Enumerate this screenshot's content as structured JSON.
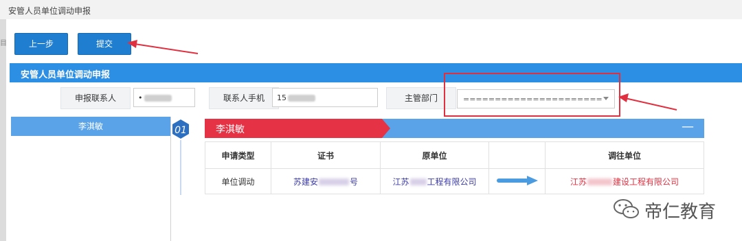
{
  "window": {
    "title": "安管人员单位调动申报"
  },
  "toolbar": {
    "prev_label": "上一步",
    "submit_label": "提交"
  },
  "section": {
    "title": "安管人员单位调动申报"
  },
  "form": {
    "contact_label": "申报联系人",
    "contact_value": "•",
    "phone_label": "联系人手机",
    "phone_value": "15",
    "dept_label": "主管部门",
    "dept_value": "======================"
  },
  "sidebar": {
    "items": [
      {
        "label": "李淇敏"
      }
    ]
  },
  "record": {
    "index": "01",
    "name": "李淇敏",
    "collapse_symbol": "—",
    "table": {
      "headers": [
        "申请类型",
        "证书",
        "原单位",
        "",
        "调往单位"
      ],
      "rows": [
        {
          "type": "单位调动",
          "certificate_start": "苏建安",
          "certificate_end": "号",
          "original_unit_start": "江苏",
          "original_unit_end": "工程有限公司",
          "target_unit_start": "江苏",
          "target_unit_end": "建设工程有限公司"
        }
      ]
    }
  },
  "watermark": {
    "text": "帝仁教育"
  },
  "colors": {
    "accent_blue": "#2d8fe4",
    "button_blue": "#1f7ed0",
    "header_red": "#e03040",
    "arrow_blue": "#4a9be0"
  }
}
